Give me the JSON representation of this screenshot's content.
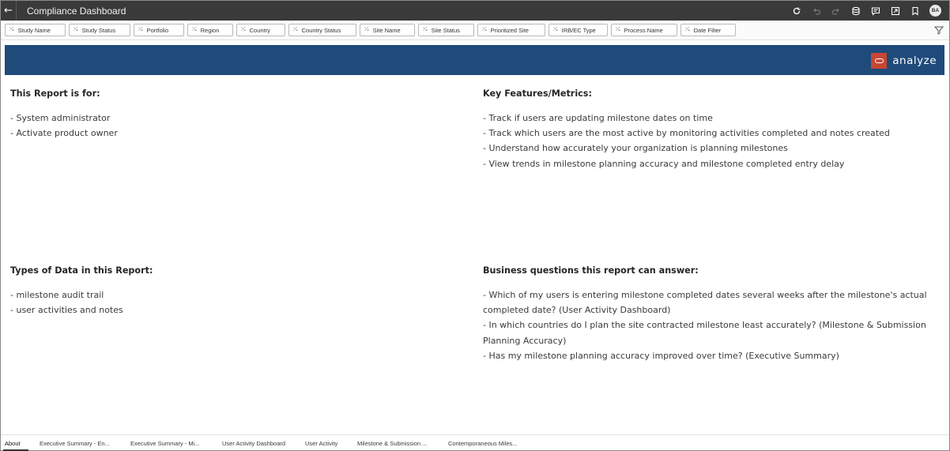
{
  "header": {
    "back_icon": "arrow-left-icon",
    "title": "Compliance Dashboard",
    "toolbar_icons": [
      "refresh-icon",
      "undo-icon",
      "redo-icon",
      "data-icon",
      "comment-icon",
      "present-icon",
      "bookmark-icon"
    ],
    "user_initials": "BA"
  },
  "filters": [
    "Study Name",
    "Study Status",
    "Portfolio",
    "Region",
    "Country",
    "Country Status",
    "Site Name",
    "Site Status",
    "Prioritized Site",
    "IRB/EC Type",
    "Process Name",
    "Date Filter"
  ],
  "banner": {
    "brand_text": "analyze",
    "brand_color": "#c74634",
    "banner_color": "#1f4b7a"
  },
  "sections": {
    "report_for": {
      "heading": "This Report is for:",
      "lines": [
        "- System administrator",
        "- Activate product owner"
      ]
    },
    "key_features": {
      "heading": "Key Features/Metrics:",
      "lines": [
        "- Track if users are updating milestone dates on time",
        "- Track which users are the most active by monitoring activities completed and notes created",
        "- Understand how accurately your organization is planning milestones",
        "- View trends in milestone planning accuracy and milestone completed entry delay"
      ]
    },
    "data_types": {
      "heading": "Types of Data in this Report:",
      "lines": [
        "- milestone audit trail",
        "- user activities and notes"
      ]
    },
    "business_questions": {
      "heading": "Business questions this report can answer:",
      "lines": [
        "- Which of my users is entering milestone completed dates several weeks after the milestone's actual",
        "completed date? (User Activity Dashboard)",
        "- In which countries do I plan the site contracted milestone least accurately? (Milestone & Submission",
        "Planning Accuracy)",
        "- Has my milestone planning accuracy improved over time? (Executive Summary)"
      ]
    }
  },
  "tabs": [
    {
      "label": "About",
      "active": true
    },
    {
      "label": "Executive Summary - En...",
      "active": false
    },
    {
      "label": "Executive Summary - Mi...",
      "active": false
    },
    {
      "label": "User Activity Dashboard",
      "active": false
    },
    {
      "label": "User Activity",
      "active": false
    },
    {
      "label": "Milestone & Submission ...",
      "active": false
    },
    {
      "label": "Contemporaneous Miles...",
      "active": false
    }
  ]
}
